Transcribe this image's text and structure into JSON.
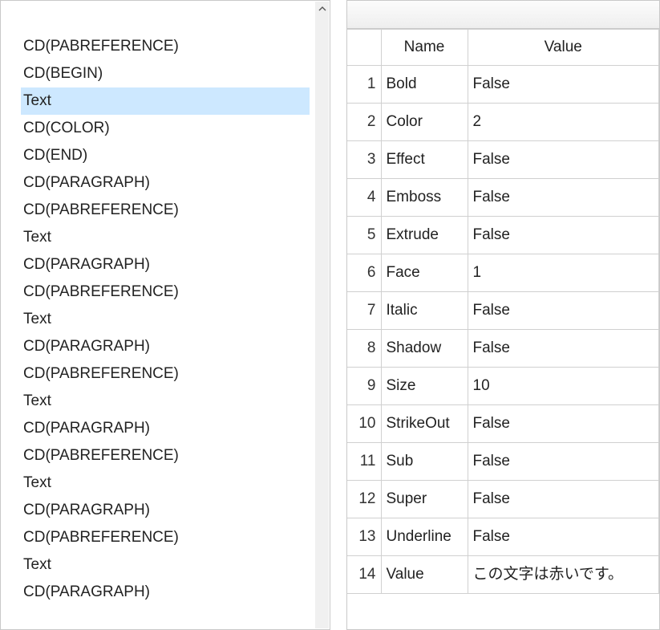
{
  "left": {
    "selected_index": 2,
    "items": [
      "CD(PABREFERENCE)",
      "CD(BEGIN)",
      "Text",
      "CD(COLOR)",
      "CD(END)",
      "CD(PARAGRAPH)",
      "CD(PABREFERENCE)",
      "Text",
      "CD(PARAGRAPH)",
      "CD(PABREFERENCE)",
      "Text",
      "CD(PARAGRAPH)",
      "CD(PABREFERENCE)",
      "Text",
      "CD(PARAGRAPH)",
      "CD(PABREFERENCE)",
      "Text",
      "CD(PARAGRAPH)",
      "CD(PABREFERENCE)",
      "Text",
      "CD(PARAGRAPH)"
    ]
  },
  "grid": {
    "row_header_label": "",
    "columns": [
      "Name",
      "Value"
    ],
    "rows": [
      {
        "n": "1",
        "name": "Bold",
        "value": "False"
      },
      {
        "n": "2",
        "name": "Color",
        "value": "2"
      },
      {
        "n": "3",
        "name": "Effect",
        "value": "False"
      },
      {
        "n": "4",
        "name": "Emboss",
        "value": "False"
      },
      {
        "n": "5",
        "name": "Extrude",
        "value": "False"
      },
      {
        "n": "6",
        "name": "Face",
        "value": "1"
      },
      {
        "n": "7",
        "name": "Italic",
        "value": "False"
      },
      {
        "n": "8",
        "name": "Shadow",
        "value": "False"
      },
      {
        "n": "9",
        "name": "Size",
        "value": "10"
      },
      {
        "n": "10",
        "name": "StrikeOut",
        "value": "False"
      },
      {
        "n": "11",
        "name": "Sub",
        "value": "False"
      },
      {
        "n": "12",
        "name": "Super",
        "value": "False"
      },
      {
        "n": "13",
        "name": "Underline",
        "value": "False"
      },
      {
        "n": "14",
        "name": "Value",
        "value": "この文字は赤いです。"
      }
    ]
  }
}
